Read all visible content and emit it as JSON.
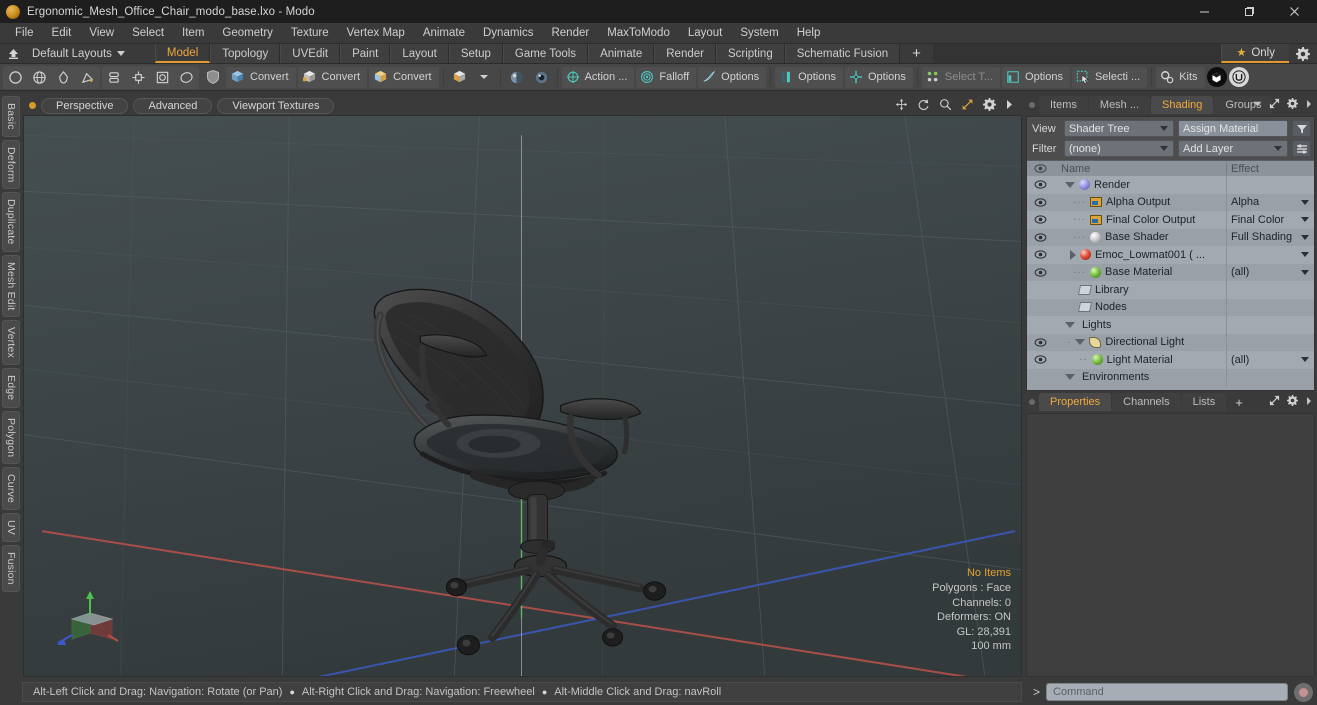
{
  "window": {
    "title": "Ergonomic_Mesh_Office_Chair_modo_base.lxo - Modo",
    "app_icon": "modo-app-icon",
    "minimize": "–",
    "maximize": "❐",
    "close": "✕"
  },
  "menubar": {
    "items": [
      {
        "label": "File"
      },
      {
        "label": "Edit"
      },
      {
        "label": "View"
      },
      {
        "label": "Select"
      },
      {
        "label": "Item"
      },
      {
        "label": "Geometry"
      },
      {
        "label": "Texture"
      },
      {
        "label": "Vertex Map"
      },
      {
        "label": "Animate"
      },
      {
        "label": "Dynamics"
      },
      {
        "label": "Render"
      },
      {
        "label": "MaxToModo"
      },
      {
        "label": "Layout"
      },
      {
        "label": "System"
      },
      {
        "label": "Help"
      }
    ]
  },
  "layout_row": {
    "home_icon": "home-layout-icon",
    "layout_selector": "Default Layouts",
    "tabs": [
      {
        "label": "Model",
        "active": true
      },
      {
        "label": "Topology",
        "active": false
      },
      {
        "label": "UVEdit",
        "active": false
      },
      {
        "label": "Paint",
        "active": false
      },
      {
        "label": "Layout",
        "active": false
      },
      {
        "label": "Setup",
        "active": false
      },
      {
        "label": "Game Tools",
        "active": false
      },
      {
        "label": "Animate",
        "active": false
      },
      {
        "label": "Render",
        "active": false
      },
      {
        "label": "Scripting",
        "active": false
      },
      {
        "label": "Schematic Fusion",
        "active": false
      }
    ],
    "add_tab": "+",
    "only_toggle": "Only",
    "only_star": "★",
    "gear": "gear-icon"
  },
  "toolbar": {
    "primitives": [
      {
        "icon": "circle-primitive-icon"
      },
      {
        "icon": "sphere-primitive-icon"
      },
      {
        "icon": "cone-primitive-icon"
      },
      {
        "icon": "pen-primitive-icon"
      }
    ],
    "ops": [
      {
        "icon": "stack-icon"
      },
      {
        "icon": "center-cross-icon"
      },
      {
        "icon": "square-target-icon"
      },
      {
        "icon": "ellipse-icon"
      }
    ],
    "shield": {
      "icon": "shield-icon"
    },
    "convert_buttons": [
      {
        "label": "Convert",
        "icon": "convert-blue-icon"
      },
      {
        "label": "Convert",
        "icon": "convert-white-icon"
      },
      {
        "label": "Convert",
        "icon": "convert-orange-icon"
      },
      {
        "label": "",
        "icon": "convert-yellow-icon"
      }
    ],
    "convert_dropdown": "▾",
    "paint_icons": [
      {
        "icon": "paint-sphere-icon"
      },
      {
        "icon": "paint-sphere-dark-icon"
      }
    ],
    "action_center": {
      "label": "Action  ...",
      "icon": "action-center-icon"
    },
    "falloff": {
      "label": "Falloff",
      "icon": "falloff-icon"
    },
    "options_1": {
      "label": "Options",
      "icon": "tool-options-icon"
    },
    "options_2": {
      "label": "Options",
      "icon": "symmetry-options-icon"
    },
    "options_3": {
      "label": "Options",
      "icon": "snap-options-icon"
    },
    "select_through": {
      "label": "Select T...",
      "icon": "select-through-icon"
    },
    "options_4": {
      "label": "Options",
      "icon": "layout-options-icon"
    },
    "selection": {
      "label": "Selecti ...",
      "icon": "selection-icon"
    },
    "kits": {
      "label": "Kits",
      "icon": "kits-gear-icon"
    },
    "unity_btn": {
      "icon": "unity-round-icon"
    },
    "unreal_btn": {
      "icon": "unreal-u-icon"
    }
  },
  "left_strip": {
    "tabs": [
      {
        "label": "Basic"
      },
      {
        "label": "Deform"
      },
      {
        "label": "Duplicate"
      },
      {
        "label": "Mesh Edit"
      },
      {
        "label": "Vertex"
      },
      {
        "label": "Edge"
      },
      {
        "label": "Polygon"
      },
      {
        "label": "Curve"
      },
      {
        "label": "UV"
      },
      {
        "label": "Fusion"
      }
    ]
  },
  "viewport": {
    "dot": "active-viewport-dot",
    "pills": [
      {
        "label": "Perspective"
      },
      {
        "label": "Advanced"
      },
      {
        "label": "Viewport Textures"
      }
    ],
    "tools": [
      {
        "icon": "pan-icon"
      },
      {
        "icon": "rotate-icon"
      },
      {
        "icon": "zoom-magnifier-icon"
      },
      {
        "icon": "fit-expand-icon"
      },
      {
        "icon": "viewport-gear-icon"
      },
      {
        "icon": "chevron-right-icon"
      }
    ],
    "model": "ergonomic-mesh-office-chair",
    "axis_gizmo": "axis-gizmo",
    "stats": {
      "selection": "No Items",
      "polygons": "Polygons : Face",
      "channels": "Channels: 0",
      "deformers": "Deformers: ON",
      "gl": "GL: 28,391",
      "scale": "100 mm"
    }
  },
  "right_dock": {
    "top_tabs": [
      {
        "label": "Items",
        "active": false
      },
      {
        "label": "Mesh ...",
        "active": false
      },
      {
        "label": "Shading",
        "active": true
      },
      {
        "label": "Groups",
        "active": false
      }
    ],
    "top_tab_icons": [
      {
        "icon": "chevron-down-icon"
      },
      {
        "icon": "expand-icon"
      },
      {
        "icon": "gear-icon"
      },
      {
        "icon": "chevron-right-icon"
      }
    ],
    "controls": {
      "view_label": "View",
      "view_value": "Shader Tree",
      "assign_material": "Assign Material",
      "filter_button": "filter-funnel-icon",
      "filter_label": "Filter",
      "filter_value": "(none)",
      "add_layer": "Add Layer",
      "list_button": "list-options-icon"
    },
    "tree_headers": {
      "eye": "visibility-eye-icon",
      "name": "Name",
      "effect": "Effect"
    },
    "tree_rows": [
      {
        "eye": true,
        "indent": 0,
        "twist": "down",
        "icon": "sphere-render",
        "name": "Render",
        "effect": "",
        "dropdown": false
      },
      {
        "eye": true,
        "indent": 1,
        "twist": "none",
        "icon": "image-output",
        "name": "Alpha Output",
        "effect": "Alpha",
        "dropdown": true
      },
      {
        "eye": true,
        "indent": 1,
        "twist": "none",
        "icon": "image-output",
        "name": "Final Color Output",
        "effect": "Final Color",
        "dropdown": true
      },
      {
        "eye": true,
        "indent": 1,
        "twist": "none",
        "icon": "sphere-white",
        "name": "Base Shader",
        "effect": "Full Shading",
        "dropdown": true
      },
      {
        "eye": true,
        "indent": 1,
        "twist": "right",
        "icon": "sphere-red",
        "name": "Emoc_Lowmat001 ( ...",
        "effect": "",
        "dropdown": true
      },
      {
        "eye": true,
        "indent": 1,
        "twist": "none",
        "icon": "sphere-green",
        "name": "Base Material",
        "effect": "(all)",
        "dropdown": true
      },
      {
        "eye": false,
        "indent": 1,
        "twist": "none",
        "icon": "folder",
        "name": "Library",
        "effect": "",
        "dropdown": false
      },
      {
        "eye": false,
        "indent": 1,
        "twist": "none",
        "icon": "folder",
        "name": "Nodes",
        "effect": "",
        "dropdown": false
      },
      {
        "eye": false,
        "indent": 0,
        "twist": "down",
        "icon": "none",
        "name": "Lights",
        "effect": "",
        "dropdown": false
      },
      {
        "eye": true,
        "indent": 1,
        "twist": "down",
        "icon": "light",
        "name": "Directional Light",
        "effect": "",
        "dropdown": false
      },
      {
        "eye": true,
        "indent": 2,
        "twist": "none",
        "icon": "sphere-green",
        "name": "Light Material",
        "effect": "(all)",
        "dropdown": true
      },
      {
        "eye": false,
        "indent": 0,
        "twist": "down",
        "icon": "none",
        "name": "Environments",
        "effect": "",
        "dropdown": false
      }
    ],
    "bottom_tabs": [
      {
        "label": "Properties",
        "active": true
      },
      {
        "label": "Channels",
        "active": false
      },
      {
        "label": "Lists",
        "active": false
      }
    ],
    "bottom_add": "+",
    "bottom_icons": [
      {
        "icon": "expand-icon"
      },
      {
        "icon": "gear-icon"
      },
      {
        "icon": "chevron-right-icon"
      }
    ]
  },
  "statusbar": {
    "hints": [
      "Alt-Left Click and Drag: Navigation: Rotate (or Pan)",
      "Alt-Right Click and Drag: Navigation: Freewheel",
      "Alt-Middle Click and Drag: navRoll"
    ],
    "bullet": "●",
    "prompt": ">",
    "command_placeholder": "Command",
    "command_value": "",
    "record_button": "record-command-icon"
  },
  "colors": {
    "accent_orange": "#f0a93c",
    "panel_bg": "#3a3a3a",
    "toolbar_bg": "#474747",
    "tree_bg": "#9aa0a8",
    "titlebar_bg": "#1e1e1e",
    "axis_x": "#a8423a",
    "axis_z": "#3550a8",
    "axis_y": "#4ba14b"
  }
}
